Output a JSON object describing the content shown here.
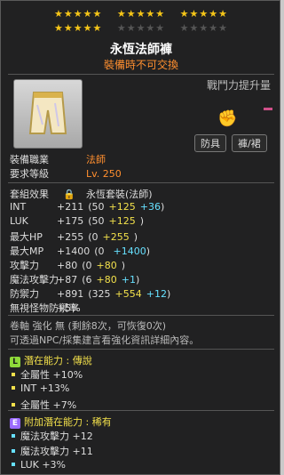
{
  "stars": {
    "row1": [
      "★★★★★",
      "★★★★★",
      "★★★★★"
    ],
    "row2_on": "★★★★★",
    "row2_off": [
      "★★★★★",
      "★★★★★"
    ]
  },
  "item": {
    "name": "永恆法師褲",
    "trade": "裝備時不可交換",
    "power_label": "戰鬥力提升量"
  },
  "chips": {
    "armor": "防具",
    "pants": "褲/裙"
  },
  "req": {
    "job_label": "裝備職業",
    "job_value": "法師",
    "level_label": "要求等級",
    "level_value": "Lv. 250"
  },
  "set": {
    "label": "套組效果",
    "value": "永恆套裝(法師)"
  },
  "stats": [
    {
      "label": "INT",
      "total": "+211",
      "open": "(50",
      "a": "+125",
      "b": "+36",
      "close": ")"
    },
    {
      "label": "LUK",
      "total": "+175",
      "open": "(50",
      "a": "+125",
      "b": "",
      "close": ")"
    },
    {
      "label": "最大HP",
      "total": "+255",
      "open": "(0",
      "a": "+255",
      "b": "",
      "close": ")"
    },
    {
      "label": "最大MP",
      "total": "+1400",
      "open": "(0",
      "a": "",
      "b": "+1400",
      "close": ")"
    },
    {
      "label": "攻擊力",
      "total": "+80",
      "open": "(0",
      "a": "+80",
      "b": "",
      "close": ")"
    },
    {
      "label": "魔法攻擊力",
      "total": "+87",
      "open": "(6",
      "a": "+80",
      "b": "+1",
      "close": ")"
    },
    {
      "label": "防禦力",
      "total": "+891",
      "open": "(325",
      "a": "+554",
      "b": "+12",
      "close": ")"
    },
    {
      "label": "無視怪物防禦率",
      "total": "+5%",
      "open": "",
      "a": "",
      "b": "",
      "close": ""
    }
  ],
  "scroll": {
    "line1": "卷軸 強化 無 (剩餘8次，可恢復0次)",
    "line2": "可透過NPC/採集建言看強化資訊詳細內容。"
  },
  "potential": {
    "tag": "L",
    "title": "潛在能力 : 傳說",
    "color": "#8fd93a",
    "lines": [
      "全屬性 +10%",
      "INT +13%",
      "全屬性 +7%"
    ]
  },
  "additional": {
    "tag": "E",
    "title": "附加潛在能力 : 稀有",
    "color": "#9b6bff",
    "lines": [
      "魔法攻擊力 +12",
      "魔法攻擊力 +11",
      "LUK +3%"
    ]
  }
}
